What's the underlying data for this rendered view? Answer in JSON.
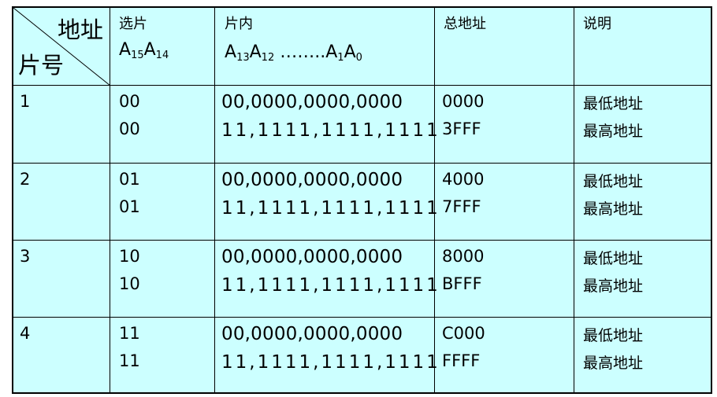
{
  "header": {
    "corner_top": "地址",
    "corner_bottom": "片号",
    "select": "选片",
    "select_pins": [
      "A",
      "15",
      "A",
      "14"
    ],
    "inner": "片内",
    "inner_pins": [
      "A",
      "13",
      "A",
      "12",
      "……..",
      "A",
      "1",
      "A",
      "0"
    ],
    "total": "总地址",
    "note": "说明"
  },
  "rows": [
    {
      "chip": "1",
      "select": [
        "00",
        "00"
      ],
      "inner": [
        "00,0000,0000,0000",
        "11,1111,1111,1111"
      ],
      "total": [
        "0000",
        "3FFF"
      ],
      "note": [
        "最低地址",
        "最高地址"
      ]
    },
    {
      "chip": "2",
      "select": [
        "01",
        "01"
      ],
      "inner": [
        "00,0000,0000,0000",
        "11,1111,1111,1111"
      ],
      "total": [
        "4000",
        "7FFF"
      ],
      "note": [
        "最低地址",
        "最高地址"
      ]
    },
    {
      "chip": "3",
      "select": [
        "10",
        "10"
      ],
      "inner": [
        "00,0000,0000,0000",
        "11,1111,1111,1111"
      ],
      "total": [
        "8000",
        "BFFF"
      ],
      "note": [
        "最低地址",
        "最高地址"
      ]
    },
    {
      "chip": "4",
      "select": [
        "11",
        "11"
      ],
      "inner": [
        "00,0000,0000,0000",
        "11,1111,1111,1111"
      ],
      "total": [
        "C000",
        "FFFF"
      ],
      "note": [
        "最低地址",
        "最高地址"
      ]
    }
  ]
}
